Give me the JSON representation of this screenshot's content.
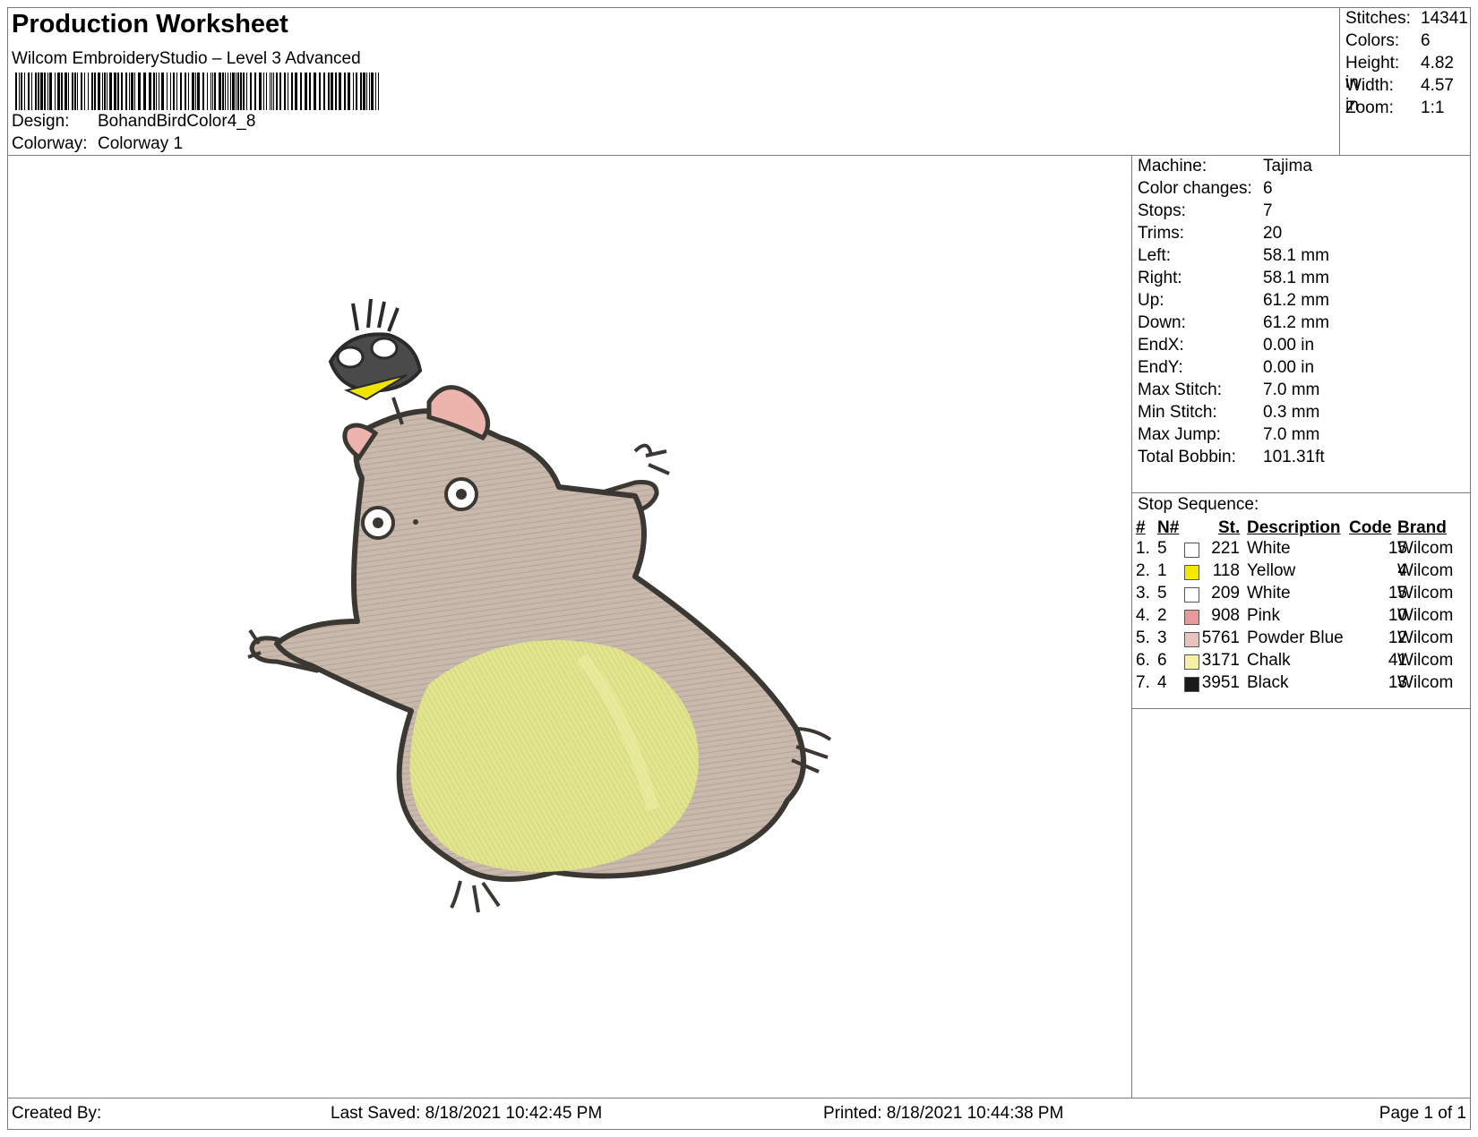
{
  "header": {
    "title": "Production Worksheet",
    "software": "Wilcom EmbroideryStudio – Level 3 Advanced",
    "design_label": "Design:",
    "design_value": "BohandBirdColor4_8",
    "colorway_label": "Colorway:",
    "colorway_value": "Colorway 1"
  },
  "summary": {
    "stitches_label": "Stitches:",
    "stitches": "14341",
    "colors_label": "Colors:",
    "colors": "6",
    "height_label": "Height:",
    "height": "4.82 in",
    "width_label": "Width:",
    "width": "4.57 in",
    "zoom_label": "Zoom:",
    "zoom": "1:1"
  },
  "machine_info": [
    {
      "label": "Machine:",
      "value": "Tajima"
    },
    {
      "label": "Color changes:",
      "value": "6"
    },
    {
      "label": "Stops:",
      "value": "7"
    },
    {
      "label": "Trims:",
      "value": "20"
    },
    {
      "label": "Left:",
      "value": "58.1 mm"
    },
    {
      "label": "Right:",
      "value": "58.1 mm"
    },
    {
      "label": "Up:",
      "value": "61.2 mm"
    },
    {
      "label": "Down:",
      "value": "61.2 mm"
    },
    {
      "label": "EndX:",
      "value": "0.00 in"
    },
    {
      "label": "EndY:",
      "value": "0.00 in"
    },
    {
      "label": "Max Stitch:",
      "value": "7.0 mm"
    },
    {
      "label": "Min Stitch:",
      "value": "0.3 mm"
    },
    {
      "label": "Max Jump:",
      "value": "7.0 mm"
    },
    {
      "label": "Total Bobbin:",
      "value": "101.31ft"
    }
  ],
  "stop_sequence": {
    "title": "Stop Sequence:",
    "headers": {
      "num": "#",
      "needle": "N#",
      "st": "St.",
      "description": "Description",
      "code": "Code",
      "brand": "Brand"
    },
    "rows": [
      {
        "num": "1.",
        "needle": "5",
        "st": "221",
        "description": "White",
        "code": "15",
        "brand": "Wilcom",
        "color": "#ffffff"
      },
      {
        "num": "2.",
        "needle": "1",
        "st": "118",
        "description": "Yellow",
        "code": "4",
        "brand": "Wilcom",
        "color": "#f5e800"
      },
      {
        "num": "3.",
        "needle": "5",
        "st": "209",
        "description": "White",
        "code": "15",
        "brand": "Wilcom",
        "color": "#ffffff"
      },
      {
        "num": "4.",
        "needle": "2",
        "st": "908",
        "description": "Pink",
        "code": "10",
        "brand": "Wilcom",
        "color": "#e79a9c"
      },
      {
        "num": "5.",
        "needle": "3",
        "st": "5761",
        "description": "Powder Blue",
        "code": "12",
        "brand": "Wilcom",
        "color": "#e8c2bc"
      },
      {
        "num": "6.",
        "needle": "6",
        "st": "3171",
        "description": "Chalk",
        "code": "41",
        "brand": "Wilcom",
        "color": "#f6f0a6"
      },
      {
        "num": "7.",
        "needle": "4",
        "st": "3951",
        "description": "Black",
        "code": "13",
        "brand": "Wilcom",
        "color": "#1a1a1a"
      }
    ]
  },
  "footer": {
    "created_by": "Created By:",
    "last_saved": "Last Saved: 8/18/2021 10:42:45 PM",
    "printed": "Printed: 8/18/2021 10:44:38 PM",
    "page": "Page 1 of 1"
  },
  "colors": {
    "border": "#7a7a7a",
    "body_fill": "#c9b9ad",
    "belly_fill": "#e2e58e",
    "outline": "#3b3833",
    "ear_pink": "#ecb4ac",
    "beak_yellow": "#f2e400"
  }
}
